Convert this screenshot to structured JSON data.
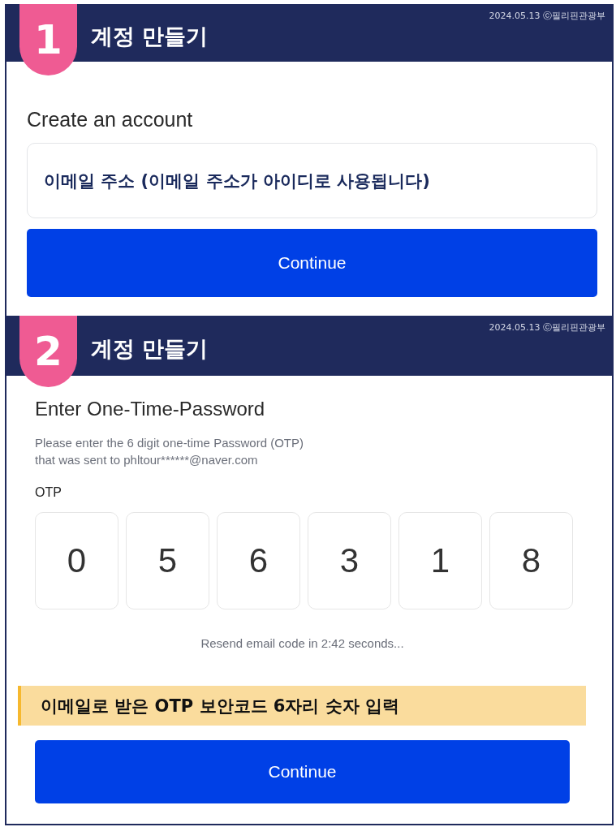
{
  "steps": [
    {
      "kind": "email",
      "number": "1",
      "title": "계정 만들기",
      "credit": "2024.05.13 ⓒ필리핀관광부",
      "heading": "Create an account",
      "email_field": {
        "placeholder": "이메일 주소 (이메일 주소가 아이디로 사용됩니다)"
      },
      "button": "Continue"
    },
    {
      "kind": "otp",
      "number": "2",
      "title": "계정 만들기",
      "credit": "2024.05.13 ⓒ필리핀관광부",
      "heading": "Enter One-Time-Password",
      "description": "Please enter the 6 digit one-time Password (OTP) that was sent to phltour******@naver.com",
      "otp_label": "OTP",
      "otp_digits": [
        "0",
        "5",
        "6",
        "3",
        "1",
        "8"
      ],
      "resend": "Resend email code in 2:42 seconds...",
      "note": "이메일로 받은 OTP 보안코드 6자리 숫자 입력",
      "button": "Continue"
    }
  ]
}
